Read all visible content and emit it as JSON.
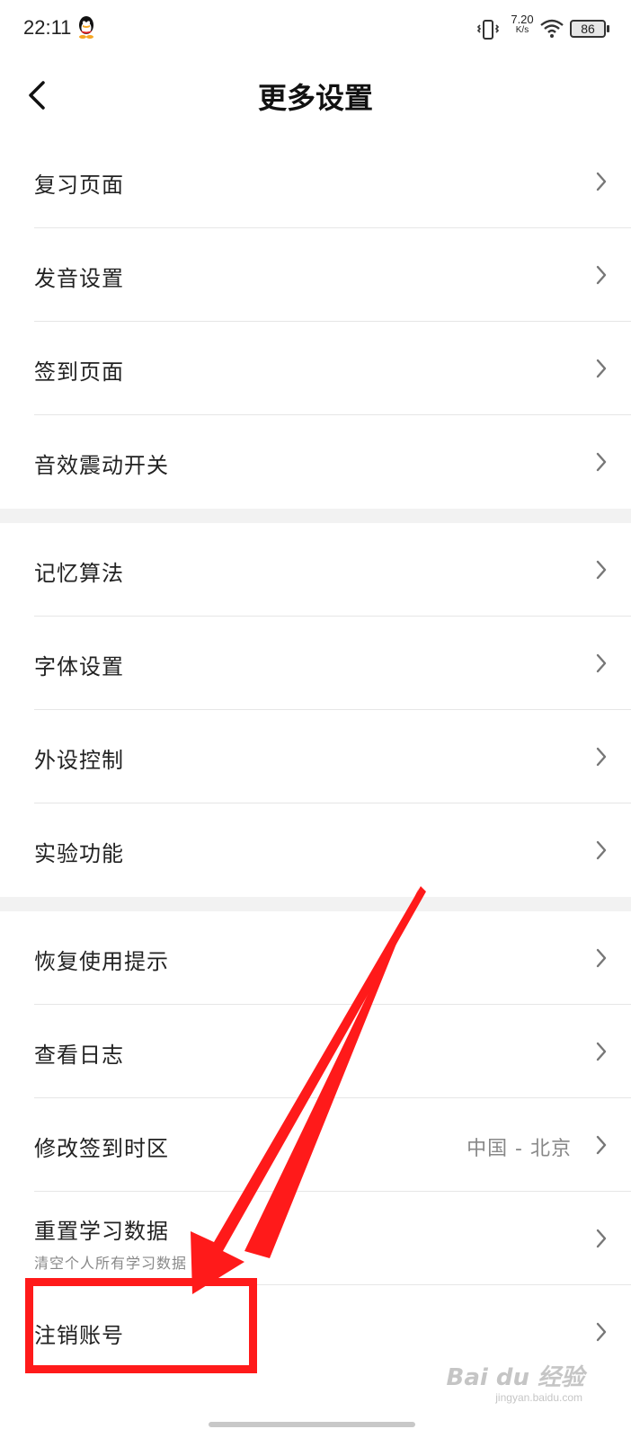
{
  "status_bar": {
    "time": "22:11",
    "net_speed_value": "7.20",
    "net_speed_unit": "K/s",
    "battery": "86",
    "icons": [
      "qq-icon",
      "vibrate-icon",
      "wifi-icon",
      "battery-icon"
    ]
  },
  "header": {
    "title": "更多设置",
    "back_icon": "chevron-left-icon"
  },
  "sections": [
    {
      "items": [
        {
          "label": "复习页面"
        },
        {
          "label": "发音设置"
        },
        {
          "label": "签到页面"
        },
        {
          "label": "音效震动开关"
        }
      ]
    },
    {
      "items": [
        {
          "label": "记忆算法"
        },
        {
          "label": "字体设置"
        },
        {
          "label": "外设控制"
        },
        {
          "label": "实验功能"
        }
      ]
    },
    {
      "items": [
        {
          "label": "恢复使用提示"
        },
        {
          "label": "查看日志"
        },
        {
          "label": "修改签到时区",
          "value": "中国 - 北京"
        },
        {
          "label": "重置学习数据",
          "sublabel": "清空个人所有学习数据"
        },
        {
          "label": "注销账号"
        }
      ]
    }
  ],
  "colors": {
    "annotation": "#ff1a1a",
    "separator": "#f2f2f2",
    "secondary_text": "#888888"
  },
  "watermark": {
    "brand": "Bai du 经验",
    "domain": "jingyan.baidu.com"
  }
}
